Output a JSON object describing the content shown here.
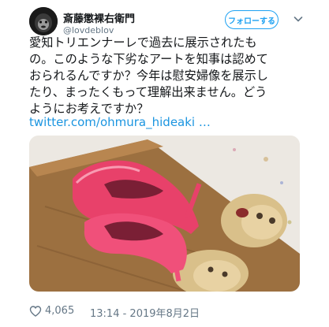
{
  "author": {
    "display_name": "斎藤懲裸右衛門",
    "handle": "@lovdeblov"
  },
  "follow_button_label": "フォローする",
  "tweet": {
    "lines": [
      "愛知トリエンナーレで過去に展示されたも",
      "の。このような下劣なアートを知事は認めて",
      "おられるんですか？今年は慰安婦像を展示し",
      "たり、まったくもって理解出来ません。どう",
      "ようにお考えですか？"
    ],
    "link_text": "twitter.com/ohmura_hideaki …"
  },
  "footer": {
    "like_count": "4,065",
    "timestamp": "13:14 - 2019年8月2日"
  },
  "colors": {
    "accent": "#1da1f2",
    "link": "#1b95e0",
    "muted": "#657786",
    "text": "#14171a"
  },
  "icons": [
    "avatar-image",
    "chevron-down-icon",
    "heart-icon"
  ]
}
